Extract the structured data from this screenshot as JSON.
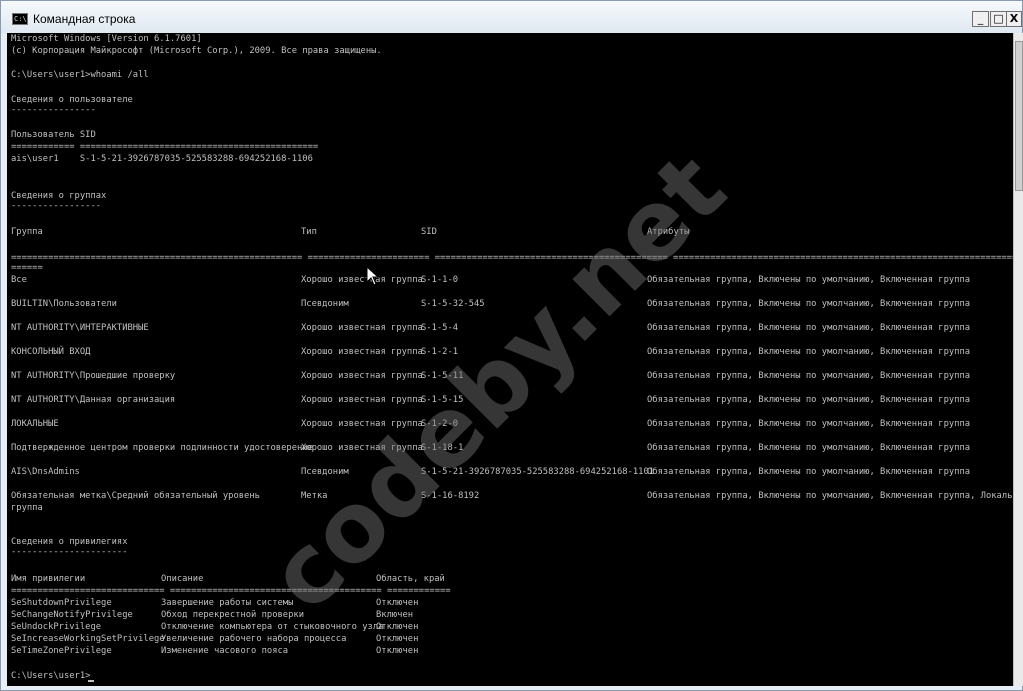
{
  "window": {
    "title": "Командная строка",
    "icon_text": "C:\\.",
    "icon": "cmd-icon",
    "minimize": "_",
    "maximize": "□",
    "close": "X"
  },
  "watermark": "codeby.net",
  "console": {
    "intro": [
      "Microsoft Windows [Version 6.1.7601]",
      "(c) Корпорация Майкрософт (Microsoft Corp.), 2009. Все права защищены."
    ],
    "command_line": "C:\\Users\\user1>whoami /all",
    "user_section": {
      "title": "Сведения о пользователе",
      "underline": "----------------",
      "header": "Пользователь SID",
      "separator": "============ =============================================",
      "row": "ais\\user1    S-1-5-21-3926787035-525583288-694252168-1106"
    },
    "groups_section": {
      "title": "Сведения о группах",
      "underline": "-----------------",
      "headers": [
        "Группа",
        "Тип",
        "SID",
        "Атрибуты"
      ],
      "separator_tail": "======",
      "rows": [
        [
          "Все",
          "Хорошо известная группа",
          "S-1-1-0",
          "Обязательная группа, Включены по умолчанию, Включенная группа"
        ],
        [
          "BUILTIN\\Пользователи",
          "Псевдоним",
          "S-1-5-32-545",
          "Обязательная группа, Включены по умолчанию, Включенная группа"
        ],
        [
          "NT AUTHORITY\\ИНТЕРАКТИВНЫЕ",
          "Хорошо известная группа",
          "S-1-5-4",
          "Обязательная группа, Включены по умолчанию, Включенная группа"
        ],
        [
          "КОНСОЛЬНЫЙ ВХОД",
          "Хорошо известная группа",
          "S-1-2-1",
          "Обязательная группа, Включены по умолчанию, Включенная группа"
        ],
        [
          "NT AUTHORITY\\Прошедшие проверку",
          "Хорошо известная группа",
          "S-1-5-11",
          "Обязательная группа, Включены по умолчанию, Включенная группа"
        ],
        [
          "NT AUTHORITY\\Данная организация",
          "Хорошо известная группа",
          "S-1-5-15",
          "Обязательная группа, Включены по умолчанию, Включенная группа"
        ],
        [
          "ЛОКАЛЬНЫЕ",
          "Хорошо известная группа",
          "S-1-2-0",
          "Обязательная группа, Включены по умолчанию, Включенная группа"
        ],
        [
          "Подтвержденное центром проверки подлинности удостоверение",
          "Хорошо известная группа",
          "S-1-18-1",
          "Обязательная группа, Включены по умолчанию, Включенная группа"
        ],
        [
          "AIS\\DnsAdmins",
          "Псевдоним",
          "S-1-5-21-3926787035-525583288-694252168-1101",
          "Обязательная группа, Включены по умолчанию, Включенная группа"
        ],
        [
          "Обязательная метка\\Средний обязательный уровень",
          "Метка",
          "S-1-16-8192",
          "Обязательная группа, Включены по умолчанию, Включенная группа, Локальная"
        ]
      ],
      "last_row_continuation": "группа"
    },
    "privileges_section": {
      "title": "Сведения о привилегиях",
      "underline": "----------------------",
      "headers": [
        "Имя привилегии",
        "Описание",
        "Область, край"
      ],
      "separator": "============================= ======================================== ============",
      "rows": [
        [
          "SeShutdownPrivilege",
          "Завершение работы системы",
          "Отключен"
        ],
        [
          "SeChangeNotifyPrivilege",
          "Обход перекрестной проверки",
          "Включен"
        ],
        [
          "SeUndockPrivilege",
          "Отключение компьютера от стыковочного узла",
          "Отключен"
        ],
        [
          "SeIncreaseWorkingSetPrivilege",
          "Увеличение рабочего набора процесса",
          "Отключен"
        ],
        [
          "SeTimeZonePrivilege",
          "Изменение часового пояса",
          "Отключен"
        ]
      ]
    },
    "prompt": "C:\\Users\\user1>"
  }
}
